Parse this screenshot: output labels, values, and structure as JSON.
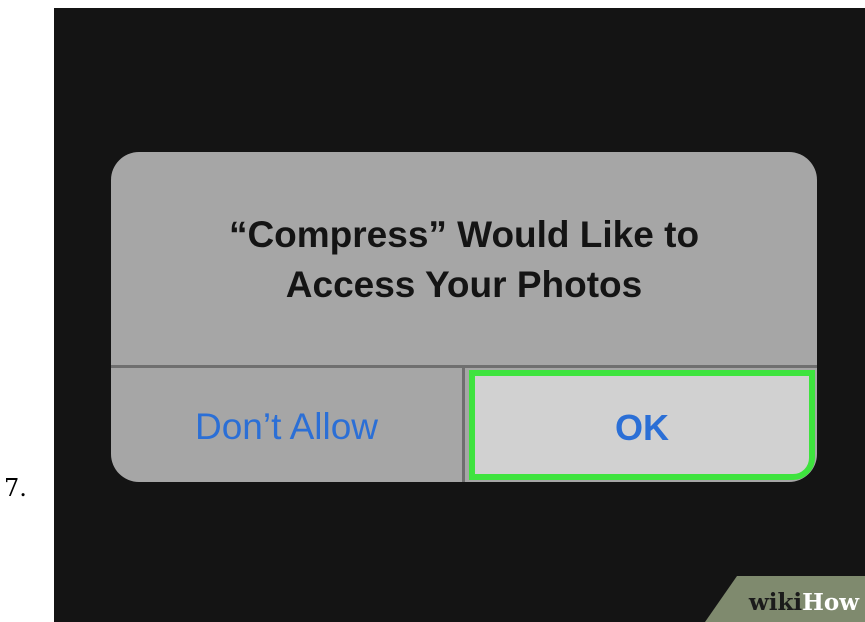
{
  "step": {
    "number": "7."
  },
  "alert": {
    "title_lines": [
      "“Compress” Would Like to",
      "Access Your Photos"
    ],
    "buttons": {
      "deny_label": "Don’t Allow",
      "ok_label": "OK"
    }
  },
  "watermark": {
    "part1": "wiki",
    "part2": "How"
  },
  "colors": {
    "background": "#141414",
    "alert_background": "#a6a6a6",
    "button_text": "#2b6fd6",
    "highlight": "#3ee33e",
    "ok_background": "#d1d1d1"
  }
}
